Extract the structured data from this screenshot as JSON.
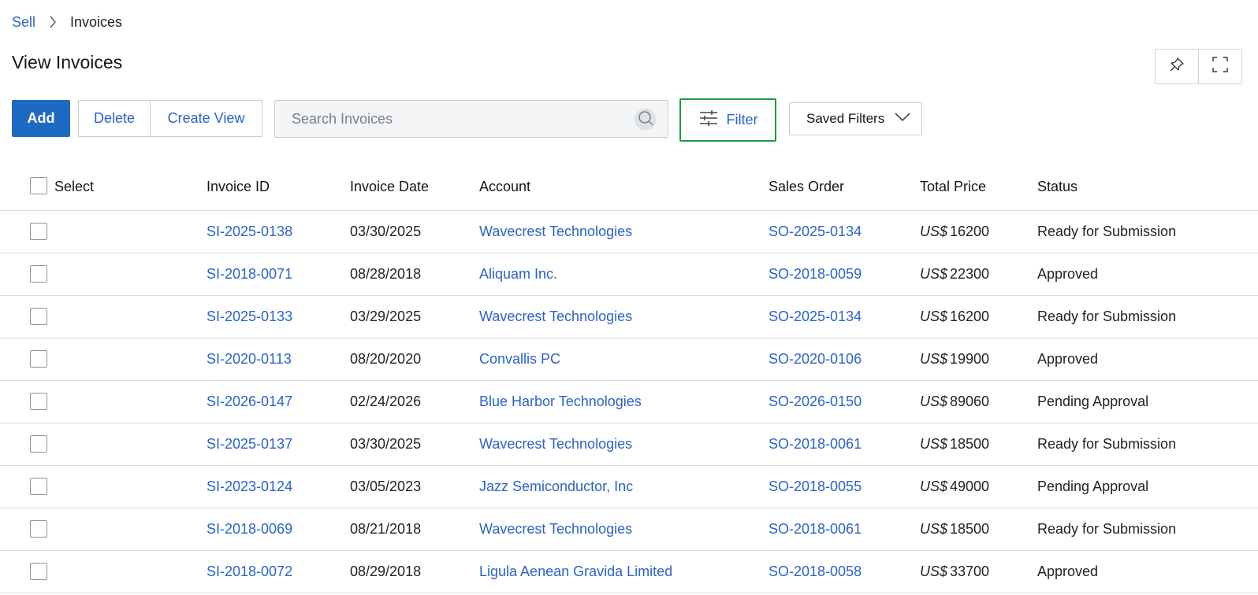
{
  "breadcrumb": {
    "parent": "Sell",
    "current": "Invoices"
  },
  "page": {
    "title": "View Invoices"
  },
  "toolbar": {
    "add_label": "Add",
    "delete_label": "Delete",
    "create_view_label": "Create View",
    "search_placeholder": "Search Invoices",
    "filter_label": "Filter",
    "saved_filters_label": "Saved Filters"
  },
  "icons": {
    "pin": "pin-icon",
    "fullscreen": "fullscreen-icon",
    "search": "search-icon",
    "filter": "sliders-icon",
    "chevron": "chevron-down-icon"
  },
  "colors": {
    "accent": "#1e6ac3",
    "link": "#2a62c9",
    "focus": "#1f9b3a"
  },
  "table": {
    "columns": [
      "Select",
      "Invoice ID",
      "Invoice Date",
      "Account",
      "Sales Order",
      "Total Price",
      "Status"
    ],
    "rows": [
      {
        "id": "SI-2025-0138",
        "date": "03/30/2025",
        "account": "Wavecrest Technologies",
        "so": "SO-2025-0134",
        "currency": "US$",
        "price": "16200",
        "status": "Ready for Submission"
      },
      {
        "id": "SI-2018-0071",
        "date": "08/28/2018",
        "account": "Aliquam Inc.",
        "so": "SO-2018-0059",
        "currency": "US$",
        "price": "22300",
        "status": "Approved"
      },
      {
        "id": "SI-2025-0133",
        "date": "03/29/2025",
        "account": "Wavecrest Technologies",
        "so": "SO-2025-0134",
        "currency": "US$",
        "price": "16200",
        "status": "Ready for Submission"
      },
      {
        "id": "SI-2020-0113",
        "date": "08/20/2020",
        "account": "Convallis PC",
        "so": "SO-2020-0106",
        "currency": "US$",
        "price": "19900",
        "status": "Approved"
      },
      {
        "id": "SI-2026-0147",
        "date": "02/24/2026",
        "account": "Blue Harbor Technologies",
        "so": "SO-2026-0150",
        "currency": "US$",
        "price": "89060",
        "status": "Pending Approval"
      },
      {
        "id": "SI-2025-0137",
        "date": "03/30/2025",
        "account": "Wavecrest Technologies",
        "so": "SO-2018-0061",
        "currency": "US$",
        "price": "18500",
        "status": "Ready for Submission"
      },
      {
        "id": "SI-2023-0124",
        "date": "03/05/2023",
        "account": "Jazz Semiconductor, Inc",
        "so": "SO-2018-0055",
        "currency": "US$",
        "price": "49000",
        "status": "Pending Approval"
      },
      {
        "id": "SI-2018-0069",
        "date": "08/21/2018",
        "account": "Wavecrest Technologies",
        "so": "SO-2018-0061",
        "currency": "US$",
        "price": "18500",
        "status": "Ready for Submission"
      },
      {
        "id": "SI-2018-0072",
        "date": "08/29/2018",
        "account": "Ligula Aenean Gravida Limited",
        "so": "SO-2018-0058",
        "currency": "US$",
        "price": "33700",
        "status": "Approved"
      }
    ]
  }
}
